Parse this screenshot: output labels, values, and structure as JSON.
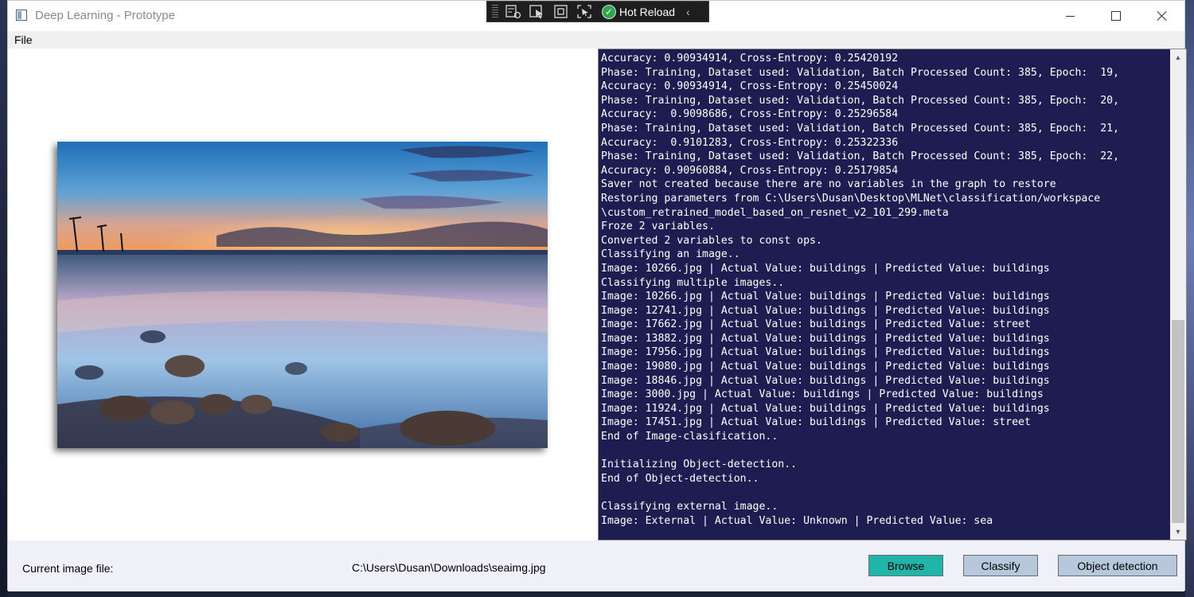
{
  "window": {
    "title": "Deep Learning - Prototype"
  },
  "hot_reload": {
    "label": "Hot Reload",
    "icons": [
      "live-visual-tree-icon",
      "select-element-icon",
      "display-layout-adorners-icon",
      "track-focus-icon",
      "hot-reload-check-icon",
      "collapse-chevron-icon"
    ]
  },
  "menu": {
    "file": "File"
  },
  "console": {
    "lines": [
      "Accuracy: 0.90934914, Cross-Entropy: 0.25420192",
      "Phase: Training, Dataset used: Validation, Batch Processed Count: 385, Epoch:  19,",
      "Accuracy: 0.90934914, Cross-Entropy: 0.25450024",
      "Phase: Training, Dataset used: Validation, Batch Processed Count: 385, Epoch:  20,",
      "Accuracy:  0.9098686, Cross-Entropy: 0.25296584",
      "Phase: Training, Dataset used: Validation, Batch Processed Count: 385, Epoch:  21,",
      "Accuracy:  0.9101283, Cross-Entropy: 0.25322336",
      "Phase: Training, Dataset used: Validation, Batch Processed Count: 385, Epoch:  22,",
      "Accuracy: 0.90960884, Cross-Entropy: 0.25179854",
      "Saver not created because there are no variables in the graph to restore",
      "Restoring parameters from C:\\Users\\Dusan\\Desktop\\MLNet\\classification/workspace",
      "\\custom_retrained_model_based_on_resnet_v2_101_299.meta",
      "Froze 2 variables.",
      "Converted 2 variables to const ops.",
      "Classifying an image..",
      "Image: 10266.jpg | Actual Value: buildings | Predicted Value: buildings",
      "Classifying multiple images..",
      "Image: 10266.jpg | Actual Value: buildings | Predicted Value: buildings",
      "Image: 12741.jpg | Actual Value: buildings | Predicted Value: buildings",
      "Image: 17662.jpg | Actual Value: buildings | Predicted Value: street",
      "Image: 13882.jpg | Actual Value: buildings | Predicted Value: buildings",
      "Image: 17956.jpg | Actual Value: buildings | Predicted Value: buildings",
      "Image: 19080.jpg | Actual Value: buildings | Predicted Value: buildings",
      "Image: 18846.jpg | Actual Value: buildings | Predicted Value: buildings",
      "Image: 3000.jpg | Actual Value: buildings | Predicted Value: buildings",
      "Image: 11924.jpg | Actual Value: buildings | Predicted Value: buildings",
      "Image: 17451.jpg | Actual Value: buildings | Predicted Value: street",
      "End of Image-clasification..",
      "",
      "Initializing Object-detection..",
      "End of Object-detection..",
      "",
      "Classifying external image..",
      "Image: External | Actual Value: Unknown | Predicted Value: sea"
    ]
  },
  "footer": {
    "current_label": "Current image file:",
    "current_path": "C:\\Users\\Dusan\\Downloads\\seaimg.jpg",
    "browse_label": "Browse",
    "classify_label": "Classify",
    "object_detection_label": "Object detection"
  },
  "colors": {
    "console_bg": "#1e1d52",
    "browse_bg": "#1fb5a8",
    "button_bg": "#b7c8dc"
  }
}
